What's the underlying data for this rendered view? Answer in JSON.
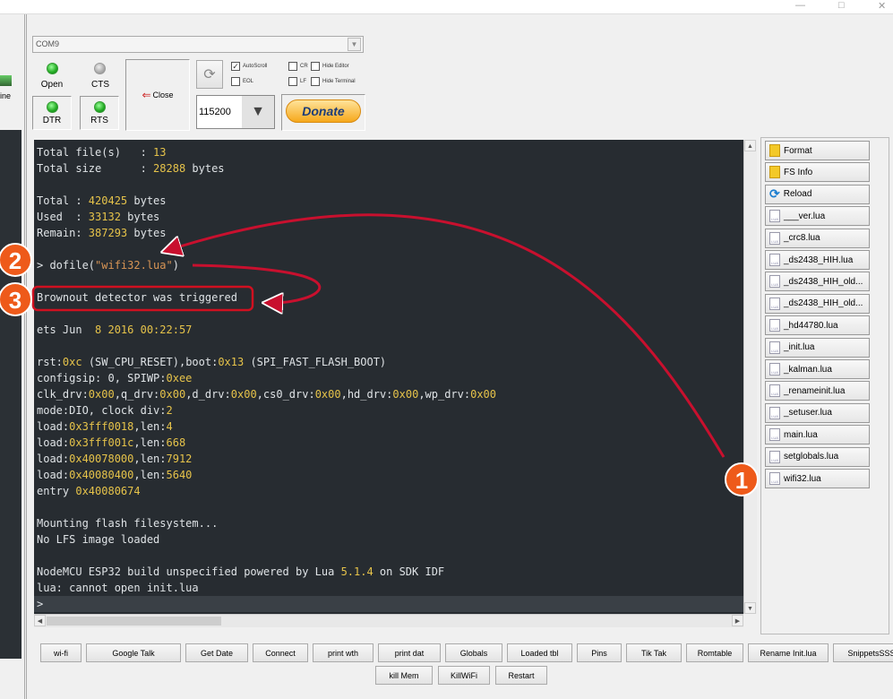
{
  "window": {
    "controls": [
      "—",
      "□",
      "✕"
    ]
  },
  "left_panel": {
    "label": "ine"
  },
  "port": {
    "selected": "COM9"
  },
  "signals": {
    "open": "Open",
    "cts": "CTS",
    "dtr": "DTR",
    "rts": "RTS"
  },
  "close_button": "Close",
  "baud": {
    "selected": "115200"
  },
  "options": {
    "autoscroll": "AutoScroll",
    "eol": "EOL",
    "cr": "CR",
    "lf": "LF",
    "hide_editor": "Hide Editor",
    "hide_terminal": "Hide Terminal",
    "autoscroll_checked": true
  },
  "donate": "Donate",
  "terminal": {
    "lines": [
      [
        [
          "Total file(s)   : ",
          "n"
        ],
        [
          "13",
          "y"
        ]
      ],
      [
        [
          "Total size      : ",
          "n"
        ],
        [
          "28288",
          "y"
        ],
        [
          " bytes",
          "n"
        ]
      ],
      [],
      [
        [
          "Total : ",
          "n"
        ],
        [
          "420425",
          "y"
        ],
        [
          " bytes",
          "n"
        ]
      ],
      [
        [
          "Used  : ",
          "n"
        ],
        [
          "33132",
          "y"
        ],
        [
          " bytes",
          "n"
        ]
      ],
      [
        [
          "Remain: ",
          "n"
        ],
        [
          "387293",
          "y"
        ],
        [
          " bytes",
          "n"
        ]
      ],
      [],
      [
        [
          "> dofile(",
          "n"
        ],
        [
          "\"wifi32.lua\"",
          "s"
        ],
        [
          ")",
          "n"
        ]
      ],
      [],
      [
        [
          "Brownout detector was triggered",
          "n"
        ]
      ],
      [],
      [
        [
          "ets Jun  ",
          "n"
        ],
        [
          "8 2016 00:22:57",
          "y"
        ]
      ],
      [],
      [
        [
          "rst:",
          "n"
        ],
        [
          "0xc",
          "y"
        ],
        [
          " (SW_CPU_RESET),boot:",
          "n"
        ],
        [
          "0x13",
          "y"
        ],
        [
          " (SPI_FAST_FLASH_BOOT)",
          "n"
        ]
      ],
      [
        [
          "configsip: 0, SPIWP:",
          "n"
        ],
        [
          "0xee",
          "y"
        ]
      ],
      [
        [
          "clk_drv:",
          "n"
        ],
        [
          "0x00",
          "y"
        ],
        [
          ",q_drv:",
          "n"
        ],
        [
          "0x00",
          "y"
        ],
        [
          ",d_drv:",
          "n"
        ],
        [
          "0x00",
          "y"
        ],
        [
          ",cs0_drv:",
          "n"
        ],
        [
          "0x00",
          "y"
        ],
        [
          ",hd_drv:",
          "n"
        ],
        [
          "0x00",
          "y"
        ],
        [
          ",wp_drv:",
          "n"
        ],
        [
          "0x00",
          "y"
        ]
      ],
      [
        [
          "mode:DIO, clock div:",
          "n"
        ],
        [
          "2",
          "y"
        ]
      ],
      [
        [
          "load:",
          "n"
        ],
        [
          "0x3fff0018",
          "y"
        ],
        [
          ",len:",
          "n"
        ],
        [
          "4",
          "y"
        ]
      ],
      [
        [
          "load:",
          "n"
        ],
        [
          "0x3fff001c",
          "y"
        ],
        [
          ",len:",
          "n"
        ],
        [
          "668",
          "y"
        ]
      ],
      [
        [
          "load:",
          "n"
        ],
        [
          "0x40078000",
          "y"
        ],
        [
          ",len:",
          "n"
        ],
        [
          "7912",
          "y"
        ]
      ],
      [
        [
          "load:",
          "n"
        ],
        [
          "0x40080400",
          "y"
        ],
        [
          ",len:",
          "n"
        ],
        [
          "5640",
          "y"
        ]
      ],
      [
        [
          "entry ",
          "n"
        ],
        [
          "0x40080674",
          "y"
        ]
      ],
      [],
      [
        [
          "Mounting flash filesystem...",
          "n"
        ]
      ],
      [
        [
          "No LFS image loaded",
          "n"
        ]
      ],
      [],
      [
        [
          "NodeMCU ESP32 build unspecified powered by Lua ",
          "n"
        ],
        [
          "5.1.4",
          "y"
        ],
        [
          " on SDK IDF",
          "n"
        ]
      ],
      [
        [
          "lua: cannot open init.lua",
          "n"
        ]
      ],
      [
        [
          ">",
          "n"
        ]
      ]
    ]
  },
  "annotations": {
    "markers": [
      "1",
      "2",
      "3"
    ],
    "color": "#c8102e"
  },
  "file_panel": {
    "actions": [
      "Format",
      "FS Info",
      "Reload"
    ],
    "files": [
      "___ver.lua",
      "_crc8.lua",
      "_ds2438_HIH.lua",
      "_ds2438_HIH_old...",
      "_ds2438_HIH_old...",
      "_hd44780.lua",
      "_init.lua",
      "_kalman.lua",
      "_renameinit.lua",
      "_setuser.lua",
      "main.lua",
      "setglobals.lua",
      "wifi32.lua"
    ]
  },
  "snippets": {
    "row1": [
      "wi-fi",
      "Google Talk",
      "Get Date",
      "Connect",
      "print wth",
      "print dat",
      "Globals",
      "Loaded tbl",
      "Pins",
      "Tik Tak",
      "Romtable",
      "Rename Init.lua",
      "SnippetsSSSS"
    ],
    "row2": [
      "kill Mem",
      "KillWiFi",
      "Restart"
    ]
  }
}
